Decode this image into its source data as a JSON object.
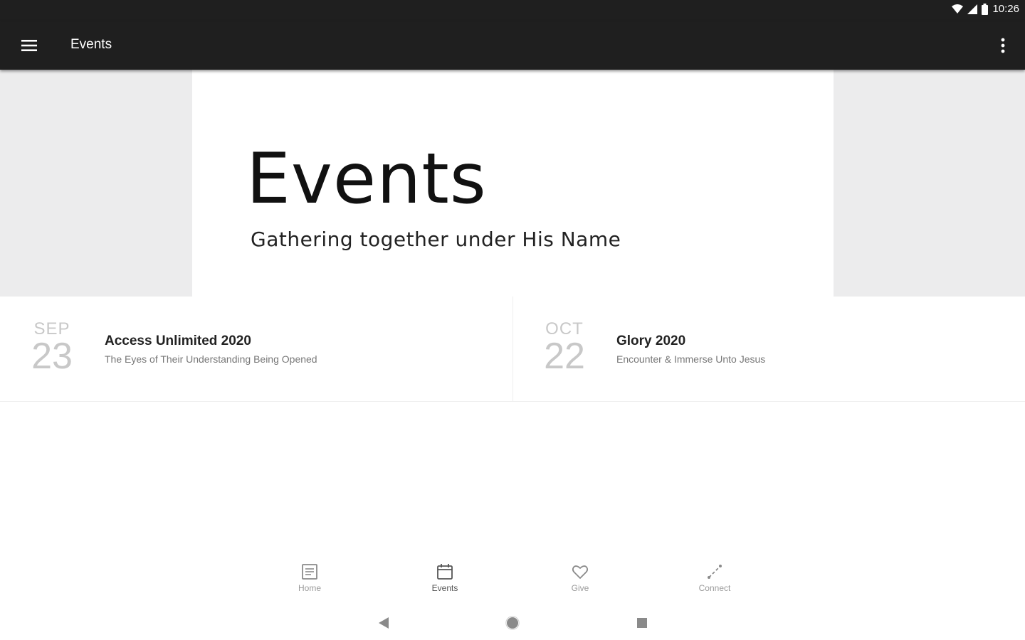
{
  "status_bar": {
    "time": "10:26",
    "icons": [
      "wifi-icon",
      "signal-icon",
      "battery-icon"
    ]
  },
  "app_bar": {
    "title": "Events",
    "menu_icon": "hamburger-menu-icon",
    "overflow_icon": "more-vertical-icon"
  },
  "hero": {
    "title": "Events",
    "subtitle": "Gathering together under His Name"
  },
  "events": [
    {
      "month": "SEP",
      "day": "23",
      "title": "Access Unlimited 2020",
      "description": "The Eyes of Their Understanding Being Opened"
    },
    {
      "month": "OCT",
      "day": "22",
      "title": "Glory 2020",
      "description": "Encounter & Immerse Unto Jesus"
    }
  ],
  "bottom_nav": [
    {
      "label": "Home",
      "icon": "home-icon",
      "active": false
    },
    {
      "label": "Events",
      "icon": "calendar-icon",
      "active": true
    },
    {
      "label": "Give",
      "icon": "heart-icon",
      "active": false
    },
    {
      "label": "Connect",
      "icon": "connect-icon",
      "active": false
    }
  ],
  "system_nav": [
    "back-icon",
    "home-circle-icon",
    "recents-icon"
  ],
  "colors": {
    "app_bar": "#1f1f1f",
    "hero_side": "#ececed",
    "date_text": "#c8c8c8"
  }
}
